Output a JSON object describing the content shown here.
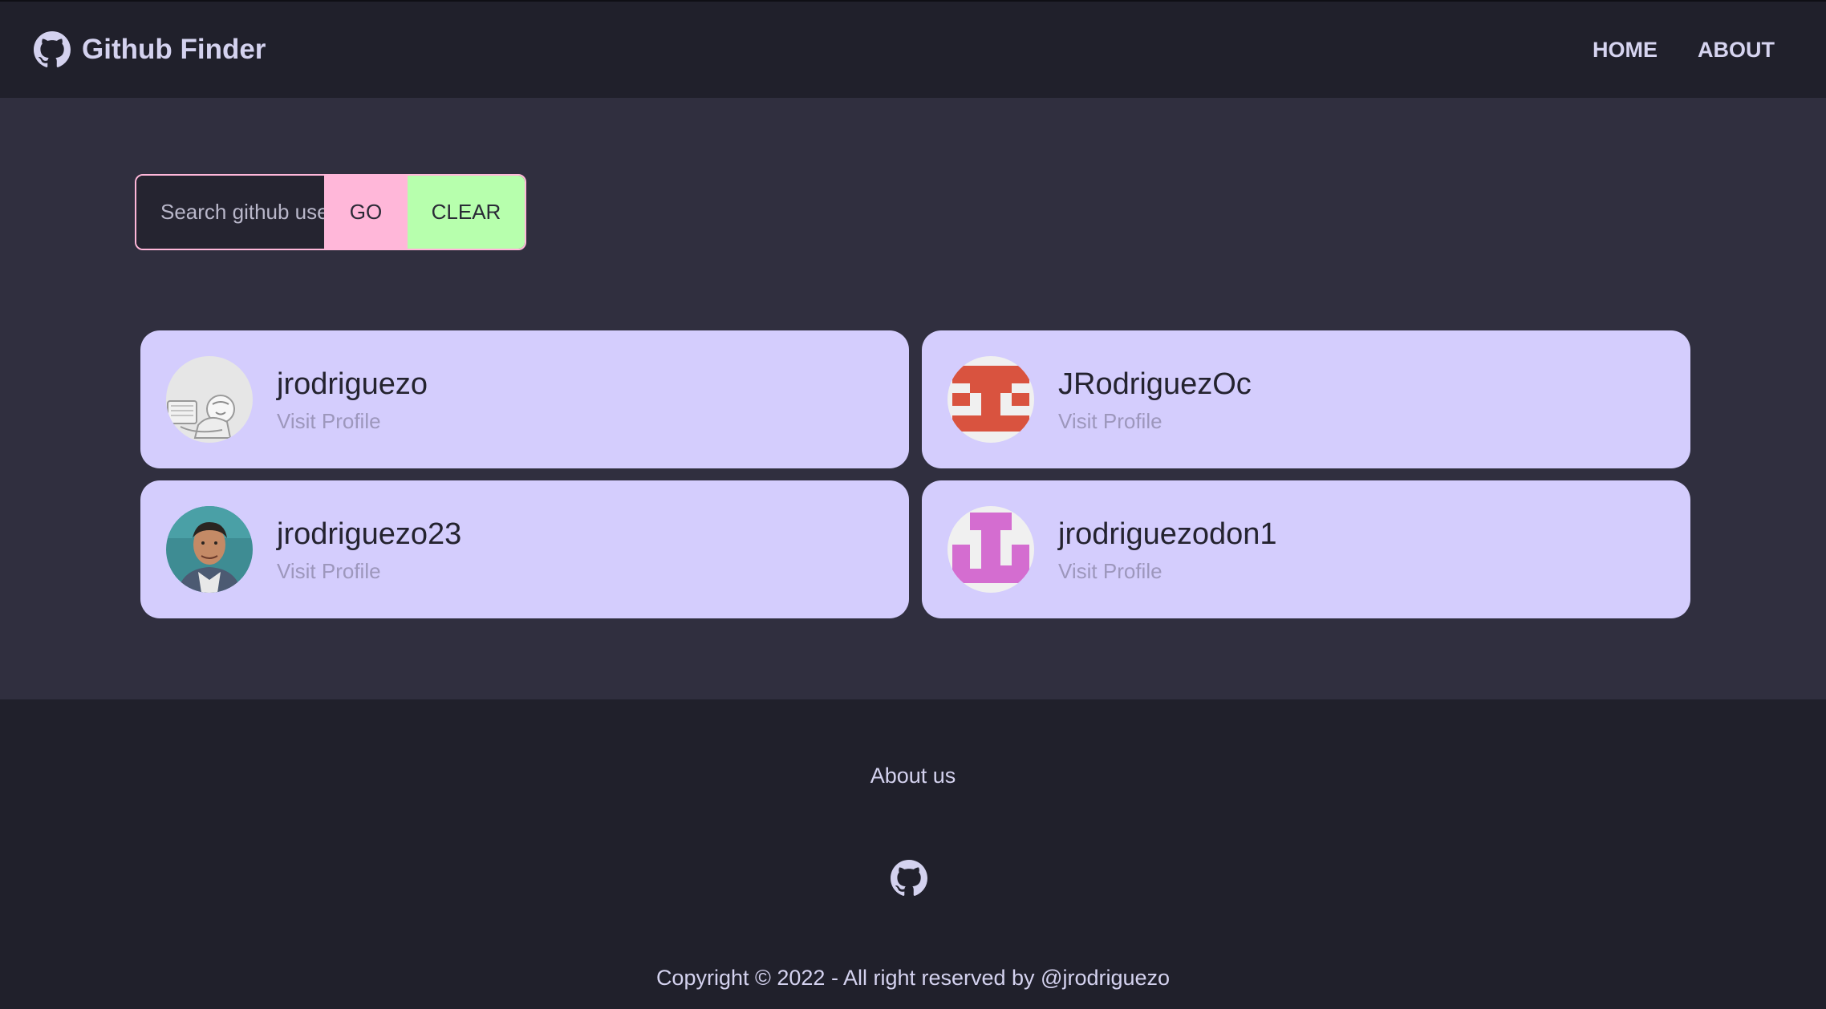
{
  "navbar": {
    "brand_icon": "github-icon",
    "brand_title": "Github Finder",
    "links": [
      "HOME",
      "ABOUT"
    ]
  },
  "search": {
    "placeholder": "Search github users...",
    "value": "",
    "go_label": "GO",
    "clear_label": "CLEAR"
  },
  "users": [
    {
      "login": "jrodriguezo",
      "link_label": "Visit Profile",
      "avatar": "line-drawing-avatar"
    },
    {
      "login": "JRodriguezOc",
      "link_label": "Visit Profile",
      "avatar": "red-identicon-avatar"
    },
    {
      "login": "jrodriguezo23",
      "link_label": "Visit Profile",
      "avatar": "photo-avatar"
    },
    {
      "login": "jrodriguezodon1",
      "link_label": "Visit Profile",
      "avatar": "pink-identicon-avatar"
    }
  ],
  "footer": {
    "about_label": "About us",
    "github_icon": "github-icon",
    "copyright": "Copyright © 2022 - All right reserved by @jrodriguezo"
  },
  "colors": {
    "navbar_bg": "#20202b",
    "main_bg": "#302f3f",
    "card_bg": "#d4cdfd",
    "go_button": "#ffb7d9",
    "clear_button": "#b7ffad",
    "text_light": "#d4d2ef"
  }
}
